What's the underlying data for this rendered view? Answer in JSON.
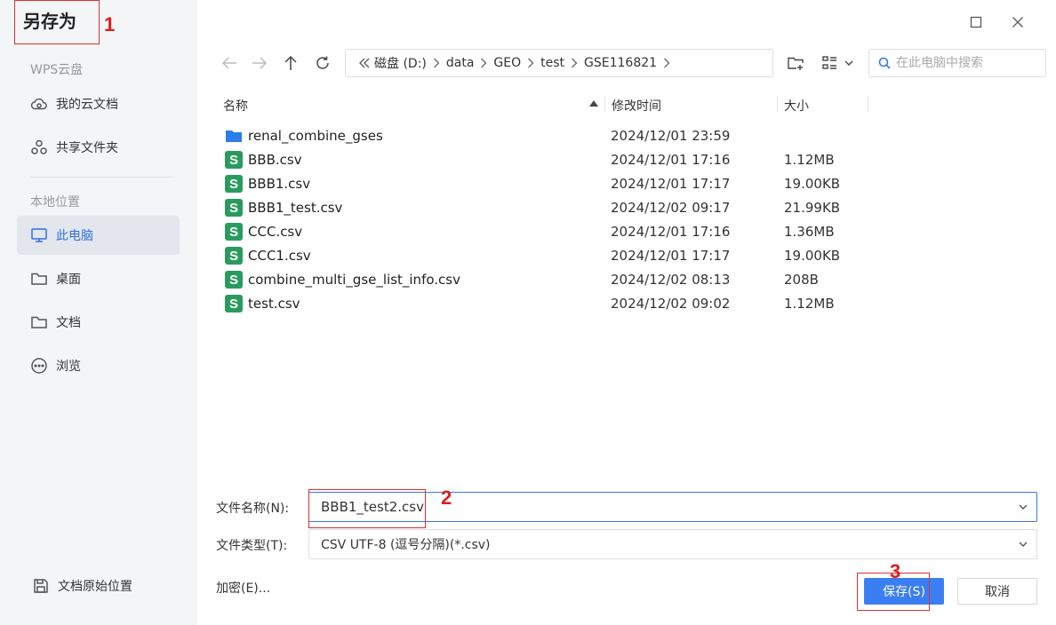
{
  "dialog": {
    "title": "另存为"
  },
  "annotations": [
    "1",
    "2",
    "3"
  ],
  "sidebar": {
    "cloud_section": "WPS云盘",
    "cloud_items": [
      {
        "label": "我的云文档",
        "icon": "cloud-icon"
      },
      {
        "label": "共享文件夹",
        "icon": "share-folder-icon"
      }
    ],
    "local_section": "本地位置",
    "local_items": [
      {
        "label": "此电脑",
        "icon": "monitor-icon",
        "active": true
      },
      {
        "label": "桌面",
        "icon": "folder-icon"
      },
      {
        "label": "文档",
        "icon": "folder-icon"
      },
      {
        "label": "浏览",
        "icon": "more-icon"
      }
    ],
    "bottom_item": {
      "label": "文档原始位置",
      "icon": "save-location-icon"
    }
  },
  "toolbar": {
    "breadcrumb": [
      "磁盘 (D:)",
      "data",
      "GEO",
      "test",
      "GSE116821"
    ],
    "search_placeholder": "在此电脑中搜索"
  },
  "file_list": {
    "columns": [
      "名称",
      "修改时间",
      "大小"
    ],
    "rows": [
      {
        "name": "renal_combine_gses",
        "modified": "2024/12/01 23:59",
        "size": "",
        "type": "folder"
      },
      {
        "name": "BBB.csv",
        "modified": "2024/12/01 17:16",
        "size": "1.12MB",
        "type": "csv"
      },
      {
        "name": "BBB1.csv",
        "modified": "2024/12/01 17:17",
        "size": "19.00KB",
        "type": "csv"
      },
      {
        "name": "BBB1_test.csv",
        "modified": "2024/12/02 09:17",
        "size": "21.99KB",
        "type": "csv"
      },
      {
        "name": "CCC.csv",
        "modified": "2024/12/01 17:16",
        "size": "1.36MB",
        "type": "csv"
      },
      {
        "name": "CCC1.csv",
        "modified": "2024/12/01 17:17",
        "size": "19.00KB",
        "type": "csv"
      },
      {
        "name": "combine_multi_gse_list_info.csv",
        "modified": "2024/12/02 08:13",
        "size": "208B",
        "type": "csv"
      },
      {
        "name": "test.csv",
        "modified": "2024/12/02 09:02",
        "size": "1.12MB",
        "type": "csv"
      }
    ]
  },
  "form": {
    "filename_label": "文件名称(N):",
    "filename_value": "BBB1_test2.csv",
    "filetype_label": "文件类型(T):",
    "filetype_value": "CSV UTF-8 (逗号分隔)(*.csv)",
    "encrypt_label": "加密(E)...",
    "save_label": "保存(S)",
    "cancel_label": "取消"
  },
  "colors": {
    "accent": "#3a7ef2",
    "annotation": "#d91e1e",
    "csv_icon": "#2a9a5f",
    "folder_icon": "#2b7de9"
  }
}
